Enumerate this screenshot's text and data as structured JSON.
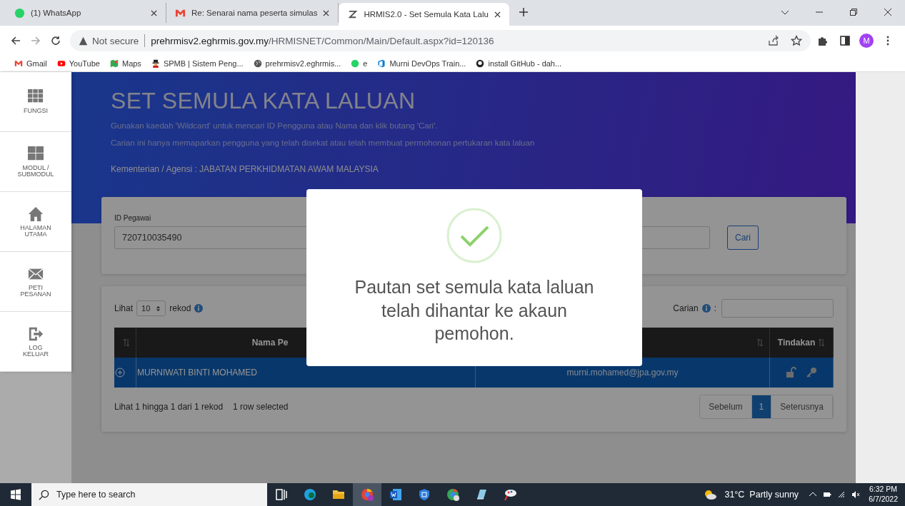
{
  "browser": {
    "tabs": [
      {
        "title": "(1) WhatsApp",
        "selected": false
      },
      {
        "title": "Re: Senarai nama peserta simulas",
        "selected": false
      },
      {
        "title": "HRMIS2.0 - Set Semula Kata Lalu",
        "selected": true
      }
    ],
    "security": "Not secure",
    "url_host": "prehrmisv2.eghrmis.gov.my",
    "url_path": "/HRMISNET/Common/Main/Default.aspx?id=120136",
    "avatar": "M",
    "bookmarks": [
      "Gmail",
      "YouTube",
      "Maps",
      "SPMB | Sistem Peng...",
      "prehrmisv2.eghrmis...",
      "e",
      "Murni DevOps Train...",
      "install GitHub - dah..."
    ]
  },
  "sidebar": {
    "items": [
      {
        "lines": [
          "FUNGSI"
        ]
      },
      {
        "lines": [
          "MODUL /",
          "SUBMODUL"
        ]
      },
      {
        "lines": [
          "HALAMAN",
          "UTAMA"
        ]
      },
      {
        "lines": [
          "PETI",
          "PESANAN"
        ]
      },
      {
        "lines": [
          "LOG",
          "KELUAR"
        ]
      }
    ]
  },
  "header": {
    "title": "SET SEMULA KATA LALUAN",
    "notes": [
      "Gunakan kaedah 'Wildcard' untuk mencari ID Pengguna atau Nama dan klik butang 'Cari'.",
      "Carian ini hanya memaparkan pengguna yang telah disekat atau telah membuat permohonan pertukaran kata laluan"
    ],
    "agency": "Kementerian / Agensi : JABATAN PERKHIDMATAN AWAM MALAYSIA"
  },
  "search_form": {
    "id_label": "ID Pegawai",
    "id_value": "720710035490",
    "button": "Cari"
  },
  "table": {
    "show_label": "Lihat",
    "page_size": "10",
    "records_label": "rekod",
    "search_label": "Carian",
    "search_colon": ":",
    "columns": [
      {
        "sortable": true
      },
      {
        "label": "Nama Pe",
        "sortable": false
      },
      {
        "sortable": true
      },
      {
        "label": "Tindakan",
        "sortable": true
      }
    ],
    "rows": [
      {
        "name": "MURNIWATI BINTI MOHAMED",
        "email": "murni.mohamed@jpa.gov.my",
        "selected": true
      }
    ],
    "info": "Lihat 1 hingga 1 dari 1 rekod",
    "selection_info": "1 row selected",
    "pagination": [
      {
        "label": "Sebelum",
        "selected": false
      },
      {
        "label": "1",
        "selected": true
      },
      {
        "label": "Seterusnya",
        "selected": false
      }
    ]
  },
  "dialog": {
    "message": "Pautan set semula kata laluan telah dihantar ke akaun pemohon."
  },
  "taskbar": {
    "search_placeholder": "Type here to search",
    "weather": "31°C  Partly sunny",
    "time": "6:32 PM",
    "date": "6/7/2022"
  }
}
